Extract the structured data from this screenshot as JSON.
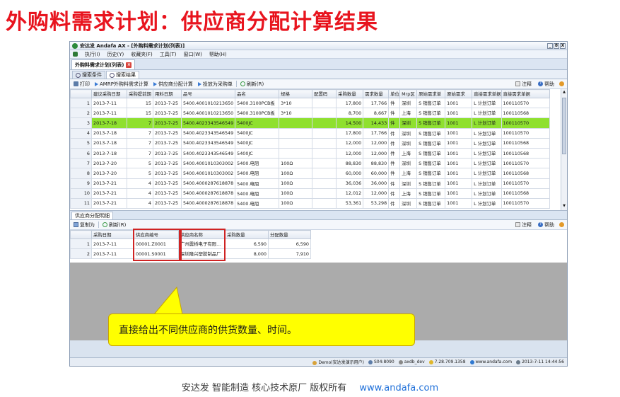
{
  "slide": {
    "title": "外购料需求计划：供应商分配计算结果"
  },
  "window": {
    "title": "安达发 Andafa AX - [外购料需求计划(列表)]",
    "controls": [
      "_",
      "8",
      "X"
    ]
  },
  "menu": [
    "执行(I)",
    "历史(Y)",
    "收藏夹(F)",
    "工具(T)",
    "窗口(W)",
    "帮助(H)"
  ],
  "doc_tab": {
    "label": "外购料需求计划(列表)"
  },
  "sub_tabs": [
    "搜索条件",
    "搜索结果"
  ],
  "toolbar": {
    "print": "打印",
    "amrp": "AMRP外购料需求计算",
    "supplier_calc": "供应商分配计算",
    "to_po": "投放为采购单",
    "refresh": "刷新(R)",
    "note": "注释",
    "help": "帮助"
  },
  "main_grid": {
    "columns": [
      "建议采购日期",
      "采购提前期",
      "用料日期",
      "品号",
      "品名",
      "规格",
      "配置码",
      "采购数量",
      "需求数量",
      "单位",
      "Mrp区",
      "原始需求单",
      "原始需求",
      "直接需求单据",
      "直接需求单据"
    ],
    "rows": [
      [
        "1",
        "2013-7-11",
        "15",
        "2013-7-25",
        "5400.4001010213650",
        "5400.3100PCB板",
        "3*10",
        "",
        "17,800",
        "17,766",
        "件",
        "深圳",
        "S 销售订单",
        "1001",
        "L 计划订单",
        "100110570"
      ],
      [
        "2",
        "2013-7-11",
        "15",
        "2013-7-25",
        "5400.4001010213650",
        "5400.3100PCB板",
        "3*10",
        "",
        "8,700",
        "8,667",
        "件",
        "上海",
        "S 销售订单",
        "1001",
        "L 计划订单",
        "100110568"
      ],
      [
        "3",
        "2013-7-18",
        "7",
        "2013-7-25",
        "5400.4023343546549",
        "5400JC",
        "",
        "",
        "14,500",
        "14,433",
        "件",
        "深圳",
        "S 销售订单",
        "1001",
        "L 计划订单",
        "100110570"
      ],
      [
        "4",
        "2013-7-18",
        "7",
        "2013-7-25",
        "5400.4023343546549",
        "5400JC",
        "",
        "",
        "17,800",
        "17,766",
        "件",
        "深圳",
        "S 销售订单",
        "1001",
        "L 计划订单",
        "100110570"
      ],
      [
        "5",
        "2013-7-18",
        "7",
        "2013-7-25",
        "5400.4023343546549",
        "5400JC",
        "",
        "",
        "12,000",
        "12,000",
        "件",
        "深圳",
        "S 销售订单",
        "1001",
        "L 计划订单",
        "100110568"
      ],
      [
        "6",
        "2013-7-18",
        "7",
        "2013-7-25",
        "5400.4023343546549",
        "5400JC",
        "",
        "",
        "12,000",
        "12,000",
        "件",
        "上海",
        "S 销售订单",
        "1001",
        "L 计划订单",
        "100110568"
      ],
      [
        "7",
        "2013-7-20",
        "5",
        "2013-7-25",
        "5400.4001010303002",
        "5400.电阻",
        "100Ω",
        "",
        "88,830",
        "88,830",
        "件",
        "深圳",
        "S 销售订单",
        "1001",
        "L 计划订单",
        "100110570"
      ],
      [
        "8",
        "2013-7-20",
        "5",
        "2013-7-25",
        "5400.4001010303002",
        "5400.电阻",
        "100Ω",
        "",
        "60,000",
        "60,000",
        "件",
        "上海",
        "S 销售订单",
        "1001",
        "L 计划订单",
        "100110568"
      ],
      [
        "9",
        "2013-7-21",
        "4",
        "2013-7-25",
        "5400.4000287618878",
        "5400.电阻",
        "100Ω",
        "",
        "36,036",
        "36,000",
        "件",
        "深圳",
        "S 销售订单",
        "1001",
        "L 计划订单",
        "100110570"
      ],
      [
        "10",
        "2013-7-21",
        "4",
        "2013-7-25",
        "5400.4000287618878",
        "5400.电阻",
        "100Ω",
        "",
        "12,012",
        "12,000",
        "件",
        "上海",
        "S 销售订单",
        "1001",
        "L 计划订单",
        "100110568"
      ],
      [
        "11",
        "2013-7-21",
        "4",
        "2013-7-25",
        "5400.4000287618878",
        "5400.电阻",
        "100Ω",
        "",
        "53,361",
        "53,298",
        "件",
        "深圳",
        "S 销售订单",
        "1001",
        "L 计划订单",
        "100110570"
      ]
    ],
    "selected_row": 2
  },
  "lower_tab": {
    "label": "供应商分配明细"
  },
  "lower_toolbar": {
    "copy": "复制为",
    "refresh": "刷新(R)",
    "note": "注释",
    "help": "帮助"
  },
  "detail_grid": {
    "columns": [
      "采购日期",
      "供应商编号",
      "供应商名称",
      "采购数量",
      "分配数量"
    ],
    "rows": [
      [
        "1",
        "2013-7-11",
        "00001.Z0001",
        "广州震桥电子有限...",
        "6,590",
        "6,590"
      ],
      [
        "2",
        "2013-7-11",
        "00001.S0001",
        "深圳隆兴塑胶制品厂",
        "8,000",
        "7,910"
      ]
    ]
  },
  "status": {
    "user": "Demo(安达发演示用户)",
    "db": "S04:8090",
    "server": "axdb_dev",
    "ip": "7.28.709.1358",
    "site": "www.andafa.com",
    "datetime": "2013-7-11 14:44:56"
  },
  "callout": {
    "text": "直接给出不同供应商的供货数量、时间。"
  },
  "footer": {
    "text": "安达发  智能制造 核心技术原厂  版权所有",
    "url": "www.andafa.com"
  },
  "colors": {
    "title_red": "#e8141e",
    "selected_row": "#8fe02f",
    "callout_yellow": "#ffff00",
    "highlight_box": "#cf2323"
  }
}
